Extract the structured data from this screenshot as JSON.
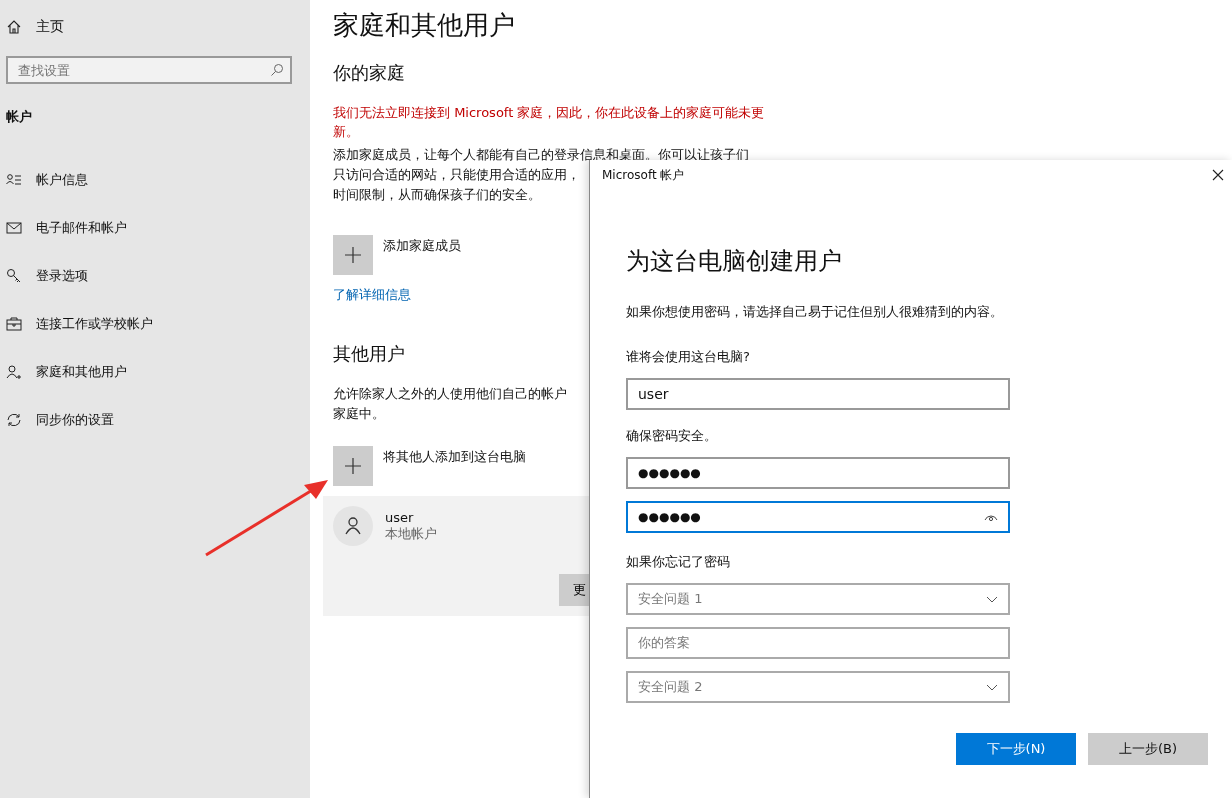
{
  "sidebar": {
    "home": {
      "label": "主页"
    },
    "search": {
      "placeholder": "查找设置"
    },
    "section": "帐户",
    "items": [
      {
        "label": "帐户信息",
        "kind": "info"
      },
      {
        "label": "电子邮件和帐户",
        "kind": "mail"
      },
      {
        "label": "登录选项",
        "kind": "key"
      },
      {
        "label": "连接工作或学校帐户",
        "kind": "work"
      },
      {
        "label": "家庭和其他用户",
        "kind": "family"
      },
      {
        "label": "同步你的设置",
        "kind": "sync"
      }
    ]
  },
  "main": {
    "title": "家庭和其他用户",
    "family": {
      "heading": "你的家庭",
      "warning": "我们无法立即连接到 Microsoft 家庭，因此，你在此设备上的家庭可能未更新。",
      "description": [
        "添加家庭成员，让每个人都能有自己的登录信息和桌面。你可以让孩子们",
        "只访问合适的网站，只能使用合适的应用，",
        "时间限制，从而确保孩子们的安全。"
      ],
      "add_label": "添加家庭成员",
      "link": "了解详细信息"
    },
    "other_users": {
      "heading": "其他用户",
      "description": [
        "允许除家人之外的人使用他们自己的帐户",
        "家庭中。"
      ],
      "add_label": "将其他人添加到这台电脑",
      "user": {
        "name": "user",
        "type": "本地帐户",
        "button": "更"
      }
    }
  },
  "dialog": {
    "title": "Microsoft 帐户",
    "heading": "为这台电脑创建用户",
    "intro": "如果你想使用密码，请选择自己易于记住但别人很难猜到的内容。",
    "who_label": "谁将会使用这台电脑?",
    "username": "user",
    "password_label": "确保密码安全。",
    "password_fields": [
      {
        "value": "●●●●●●",
        "focused": false
      },
      {
        "value": "●●●●●●",
        "focused": true
      }
    ],
    "forgot_label": "如果你忘记了密码",
    "recovery": [
      {
        "kind": "dropdown",
        "placeholder": "安全问题 1"
      },
      {
        "kind": "text",
        "placeholder": "你的答案"
      },
      {
        "kind": "dropdown",
        "placeholder": "安全问题 2"
      }
    ],
    "buttons": [
      {
        "label": "下一步(N)",
        "kind": "primary"
      },
      {
        "label": "上一步(B)",
        "kind": "secondary"
      }
    ]
  }
}
